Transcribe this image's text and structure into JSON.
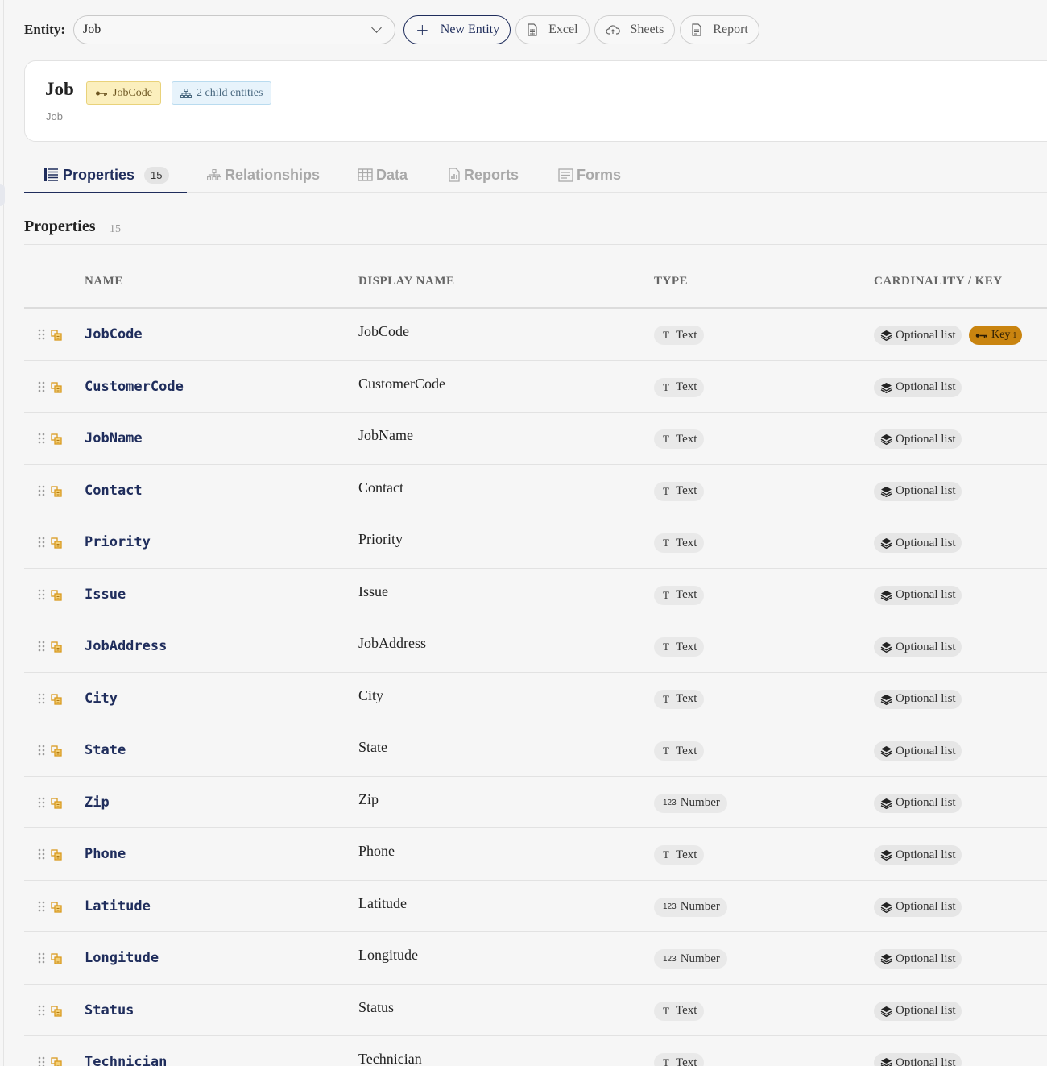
{
  "toolbar": {
    "entity_label": "Entity:",
    "entity_value": "Job",
    "buttons": {
      "new_entity": "New Entity",
      "excel": "Excel",
      "sheets": "Sheets",
      "report": "Report"
    }
  },
  "header": {
    "title": "Job",
    "subtitle": "Job",
    "key_badge": "JobCode",
    "child_badge": "2 child entities"
  },
  "tabs": [
    {
      "label": "Properties",
      "count": "15",
      "icon": "list-icon"
    },
    {
      "label": "Relationships",
      "icon": "hierarchy-icon"
    },
    {
      "label": "Data",
      "icon": "table-icon"
    },
    {
      "label": "Reports",
      "icon": "report-chart-icon"
    },
    {
      "label": "Forms",
      "icon": "form-icon"
    }
  ],
  "section": {
    "title": "Properties",
    "count": "15"
  },
  "table": {
    "columns": [
      "NAME",
      "DISPLAY NAME",
      "TYPE",
      "CARDINALITY / KEY"
    ],
    "rows": [
      {
        "name": "JobCode",
        "display": "JobCode",
        "type": "Text",
        "cardinality": "Optional list",
        "key": "Key",
        "key_index": "1"
      },
      {
        "name": "CustomerCode",
        "display": "CustomerCode",
        "type": "Text",
        "cardinality": "Optional list"
      },
      {
        "name": "JobName",
        "display": "JobName",
        "type": "Text",
        "cardinality": "Optional list"
      },
      {
        "name": "Contact",
        "display": "Contact",
        "type": "Text",
        "cardinality": "Optional list"
      },
      {
        "name": "Priority",
        "display": "Priority",
        "type": "Text",
        "cardinality": "Optional list"
      },
      {
        "name": "Issue",
        "display": "Issue",
        "type": "Text",
        "cardinality": "Optional list"
      },
      {
        "name": "JobAddress",
        "display": "JobAddress",
        "type": "Text",
        "cardinality": "Optional list"
      },
      {
        "name": "City",
        "display": "City",
        "type": "Text",
        "cardinality": "Optional list"
      },
      {
        "name": "State",
        "display": "State",
        "type": "Text",
        "cardinality": "Optional list"
      },
      {
        "name": "Zip",
        "display": "Zip",
        "type": "Number",
        "cardinality": "Optional list"
      },
      {
        "name": "Phone",
        "display": "Phone",
        "type": "Text",
        "cardinality": "Optional list"
      },
      {
        "name": "Latitude",
        "display": "Latitude",
        "type": "Number",
        "cardinality": "Optional list"
      },
      {
        "name": "Longitude",
        "display": "Longitude",
        "type": "Number",
        "cardinality": "Optional list"
      },
      {
        "name": "Status",
        "display": "Status",
        "type": "Text",
        "cardinality": "Optional list"
      },
      {
        "name": "Technician",
        "display": "Technician",
        "type": "Text",
        "cardinality": "Optional list"
      }
    ]
  },
  "icons": {
    "text_type": "T",
    "number_type": "123"
  },
  "colors": {
    "primary": "#1f2d5c",
    "key_badge_bg": "#fbefbd",
    "child_badge_bg": "#e7f3fb",
    "key_pill": "#c9840f",
    "prop_icon": "#d99a1e"
  }
}
